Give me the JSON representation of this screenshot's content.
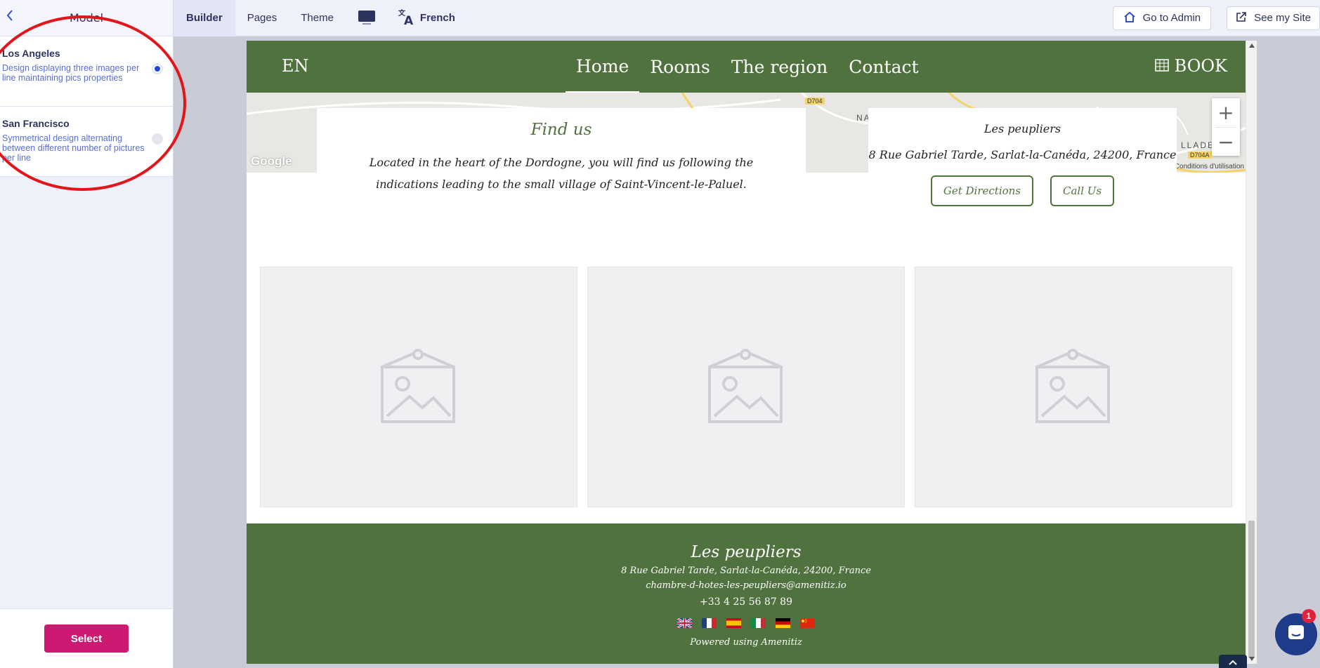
{
  "sidebar": {
    "title": "Model",
    "models": [
      {
        "name": "Los Angeles",
        "description": "Design displaying three images per line maintaining pics properties",
        "selected": true
      },
      {
        "name": "San Francisco",
        "description": "Symmetrical design alternating between different number of pictures per line",
        "selected": false
      }
    ],
    "select_label": "Select"
  },
  "topbar": {
    "tabs": [
      "Builder",
      "Pages",
      "Theme"
    ],
    "active_tab": "Builder",
    "language": "French",
    "go_admin": "Go to Admin",
    "see_site": "See my Site"
  },
  "site": {
    "lang": "EN",
    "menu": [
      "Home",
      "Rooms",
      "The region",
      "Contact"
    ],
    "active_menu": "Home",
    "book": "BOOK",
    "primary_color": "#50723e",
    "map": {
      "google": "Google",
      "terms": "Conditions d'utilisation",
      "zoom_in": "+",
      "zoom_out": "−",
      "labels": [
        "D704",
        "D704A",
        "NA",
        "LLADE"
      ]
    },
    "findus": {
      "title": "Find us",
      "text": "Located in the heart of the Dordogne, you will find us following the indications leading to the small village of Saint-Vincent-le-Paluel."
    },
    "address_card": {
      "name": "Les peupliers",
      "address": "8 Rue Gabriel Tarde, Sarlat-la-Canéda, 24200, France",
      "directions": "Get Directions",
      "call": "Call Us"
    },
    "footer": {
      "name": "Les peupliers",
      "address": "8 Rue Gabriel Tarde, Sarlat-la-Canéda, 24200, France",
      "email": "chambre-d-hotes-les-peupliers@amenitiz.io",
      "phone": "+33 4 25 56 87 89",
      "flags": [
        "uk-flag",
        "france-flag",
        "spain-flag",
        "italy-flag",
        "germany-flag",
        "china-flag"
      ],
      "powered": "Powered using Amenitiz"
    }
  },
  "chat": {
    "badge": "1"
  }
}
